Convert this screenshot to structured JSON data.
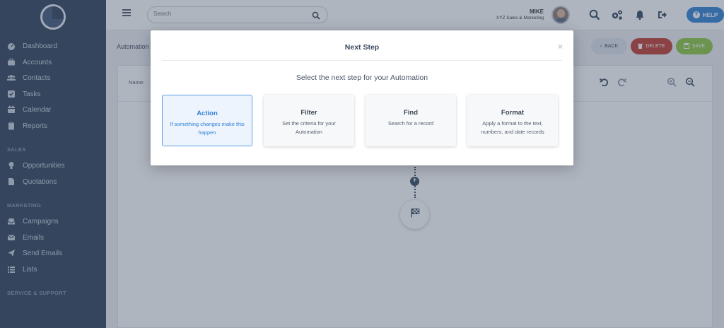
{
  "sidebar": {
    "items": [
      {
        "label": "Dashboard",
        "icon": "dashboard-icon"
      },
      {
        "label": "Accounts",
        "icon": "briefcase-icon"
      },
      {
        "label": "Contacts",
        "icon": "users-icon"
      },
      {
        "label": "Tasks",
        "icon": "checkbox-icon"
      },
      {
        "label": "Calendar",
        "icon": "calendar-icon"
      },
      {
        "label": "Reports",
        "icon": "clipboard-icon"
      }
    ],
    "sections": {
      "sales": "SALES",
      "marketing": "MARKETING",
      "service": "SERVICE & SUPPORT"
    },
    "sales_items": [
      {
        "label": "Opportunities",
        "icon": "lightbulb-icon"
      },
      {
        "label": "Quotations",
        "icon": "document-icon"
      }
    ],
    "marketing_items": [
      {
        "label": "Campaigns",
        "icon": "inbox-icon"
      },
      {
        "label": "Emails",
        "icon": "envelope-icon"
      },
      {
        "label": "Send Emails",
        "icon": "paper-plane-icon"
      },
      {
        "label": "Lists",
        "icon": "list-icon"
      }
    ]
  },
  "header": {
    "search_placeholder": "Search",
    "user_name": "MIKE",
    "user_org": "XYZ Sales & Marketing",
    "help_label": "HELP"
  },
  "main": {
    "breadcrumb": "Automation",
    "name_label": "Name:",
    "buttons": {
      "back": "BACK",
      "delete": "DELETE",
      "save": "SAVE"
    }
  },
  "modal": {
    "title": "Next Step",
    "close": "×",
    "subtitle": "Select the next step for your Automation",
    "cards": [
      {
        "title": "Action",
        "desc": "If something changes make this happen"
      },
      {
        "title": "Filter",
        "desc": "Set the criteria for your Automation"
      },
      {
        "title": "Find",
        "desc": "Search for a record"
      },
      {
        "title": "Format",
        "desc": "Apply a format to the text, numbers, and date records"
      }
    ]
  },
  "colors": {
    "sidebar": "#2c3e57",
    "accent": "#2f80d4",
    "delete": "#c0392b",
    "save": "#8cc63f",
    "back": "#dde2e8"
  }
}
